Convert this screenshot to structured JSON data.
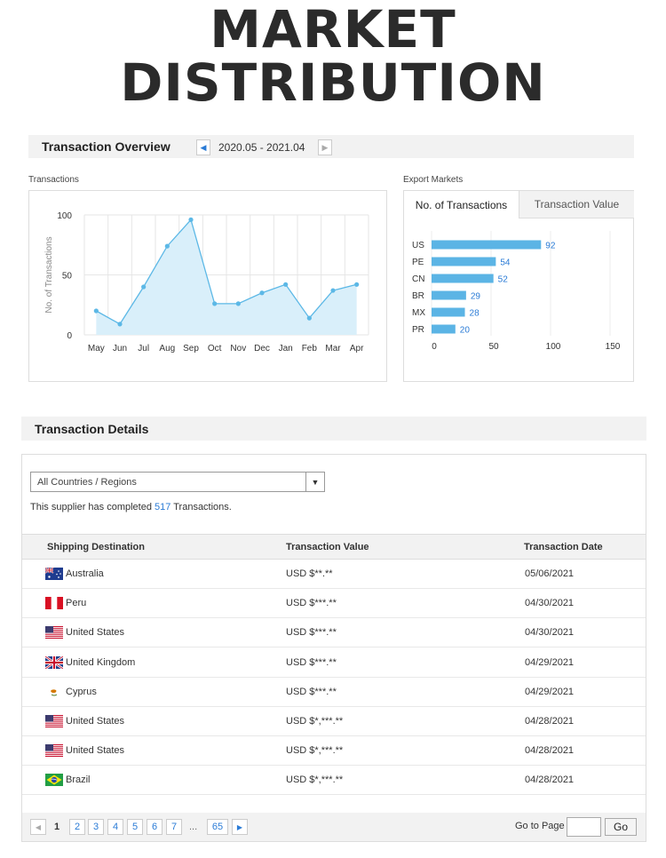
{
  "banner": {
    "line1": "MARKET",
    "line2": "DISTRIBUTION"
  },
  "overview": {
    "title": "Transaction Overview",
    "date_range": "2020.05 - 2021.04",
    "transactions_label": "Transactions",
    "export_markets_label": "Export Markets"
  },
  "chart_data": [
    {
      "type": "area",
      "title": "Transactions",
      "ylabel": "No. of Transactions",
      "xlabel": "",
      "x": [
        "May",
        "Jun",
        "Jul",
        "Aug",
        "Sep",
        "Oct",
        "Nov",
        "Dec",
        "Jan",
        "Feb",
        "Mar",
        "Apr"
      ],
      "values": [
        20,
        9,
        40,
        74,
        96,
        26,
        26,
        35,
        42,
        14,
        37,
        42
      ],
      "yticks": [
        "0",
        "50",
        "100"
      ],
      "ylim": [
        0,
        100
      ],
      "grid": true,
      "color": "#5cb8e6",
      "fill": "#d9effa"
    },
    {
      "type": "bar",
      "orientation": "horizontal",
      "categories": [
        "US",
        "PE",
        "CN",
        "BR",
        "MX",
        "PR"
      ],
      "values": [
        92,
        54,
        52,
        29,
        28,
        20
      ],
      "xticks": [
        "0",
        "50",
        "100",
        "150"
      ],
      "xlim": [
        0,
        150
      ],
      "color": "#5bb4e5"
    }
  ],
  "export_tabs": [
    {
      "label": "No. of Transactions",
      "active": true
    },
    {
      "label": "Transaction Value",
      "active": false
    }
  ],
  "details": {
    "title": "Transaction Details",
    "filter_value": "All Countries / Regions",
    "summary_prefix": "This supplier has completed ",
    "summary_count": "517",
    "summary_suffix": " Transactions.",
    "columns": [
      "Shipping Destination",
      "Transaction Value",
      "Transaction Date"
    ],
    "rows": [
      {
        "flag": "australia-flag-icon",
        "country": "Australia",
        "value": "USD $**.**",
        "date": "05/06/2021"
      },
      {
        "flag": "peru-flag-icon",
        "country": "Peru",
        "value": "USD $***.**",
        "date": "04/30/2021"
      },
      {
        "flag": "usa-flag-icon",
        "country": "United States",
        "value": "USD $***.**",
        "date": "04/30/2021"
      },
      {
        "flag": "uk-flag-icon",
        "country": "United Kingdom",
        "value": "USD $***.**",
        "date": "04/29/2021"
      },
      {
        "flag": "cyprus-flag-icon",
        "country": "Cyprus",
        "value": "USD $***.**",
        "date": "04/29/2021"
      },
      {
        "flag": "usa-flag-icon",
        "country": "United States",
        "value": "USD $*,***.**",
        "date": "04/28/2021"
      },
      {
        "flag": "usa-flag-icon",
        "country": "United States",
        "value": "USD $*,***.**",
        "date": "04/28/2021"
      },
      {
        "flag": "brazil-flag-icon",
        "country": "Brazil",
        "value": "USD $*,***.**",
        "date": "04/28/2021"
      }
    ]
  },
  "pagination": {
    "pages": [
      "1",
      "2",
      "3",
      "4",
      "5",
      "6",
      "7"
    ],
    "ellipsis": "...",
    "last_page": "65",
    "go_to_label": "Go to Page",
    "go_label": "Go"
  }
}
